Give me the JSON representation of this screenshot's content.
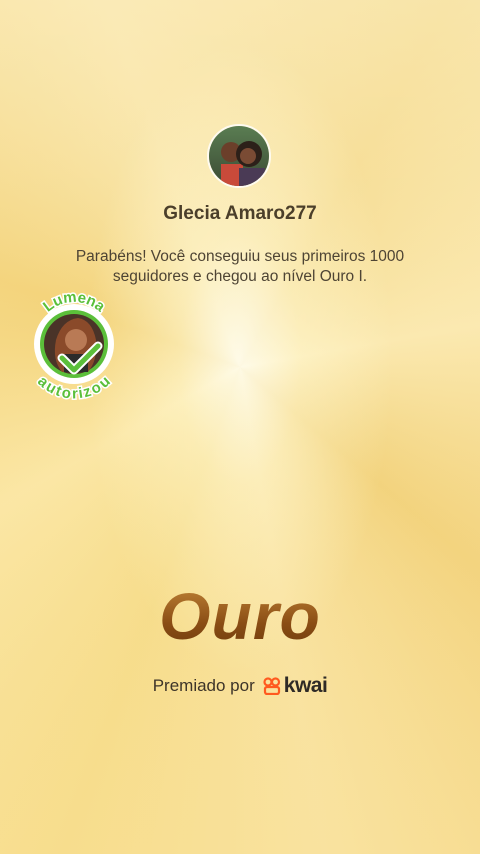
{
  "user": {
    "name": "Glecia Amaro277"
  },
  "message": "Parabéns! Você conseguiu seus primeiros 1000 seguidores e chegou ao nível Ouro I.",
  "badge": {
    "top_text": "Lumena",
    "bottom_text": "autorizou"
  },
  "level": {
    "name": "Ouro"
  },
  "footer": {
    "awarded_label": "Premiado por",
    "brand": "kwai"
  },
  "colors": {
    "gold_background": "#f6dc8a",
    "level_text": "#8a4d14",
    "badge_green": "#5bbf3a",
    "brand_orange": "#ff5a1f"
  }
}
